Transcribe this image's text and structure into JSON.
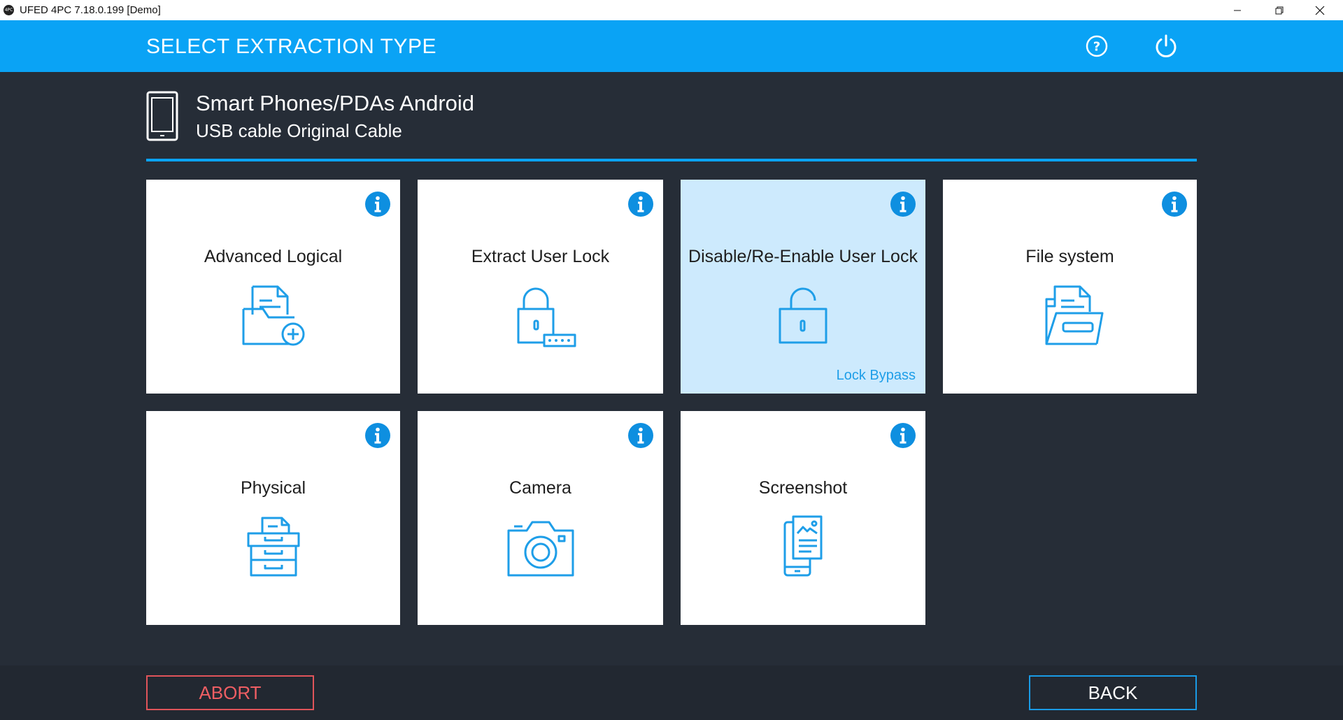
{
  "window": {
    "title": "UFED 4PC 7.18.0.199 [Demo]",
    "app_icon_text": "4PC"
  },
  "header": {
    "title": "SELECT EXTRACTION TYPE",
    "help_icon": "help-circle-icon",
    "power_icon": "power-icon"
  },
  "device": {
    "name": "Smart Phones/PDAs Android",
    "connection": "USB cable Original Cable"
  },
  "cards": [
    {
      "label": "Advanced Logical",
      "icon": "folder-document-add-icon",
      "sub": "",
      "selected": false
    },
    {
      "label": "Extract User Lock",
      "icon": "lock-password-icon",
      "sub": "",
      "selected": false
    },
    {
      "label": "Disable/Re-Enable User Lock",
      "icon": "unlock-icon",
      "sub": "Lock Bypass",
      "selected": true
    },
    {
      "label": "File system",
      "icon": "open-folder-document-icon",
      "sub": "",
      "selected": false
    },
    {
      "label": "Physical",
      "icon": "drawer-cabinet-icon",
      "sub": "",
      "selected": false
    },
    {
      "label": "Camera",
      "icon": "camera-icon",
      "sub": "",
      "selected": false
    },
    {
      "label": "Screenshot",
      "icon": "phone-screenshot-icon",
      "sub": "",
      "selected": false
    }
  ],
  "footer": {
    "abort_label": "ABORT",
    "back_label": "BACK"
  },
  "colors": {
    "accent": "#0aa3f5",
    "background": "#262d37",
    "selected_card": "#cdeafd",
    "abort": "#e0545a"
  }
}
